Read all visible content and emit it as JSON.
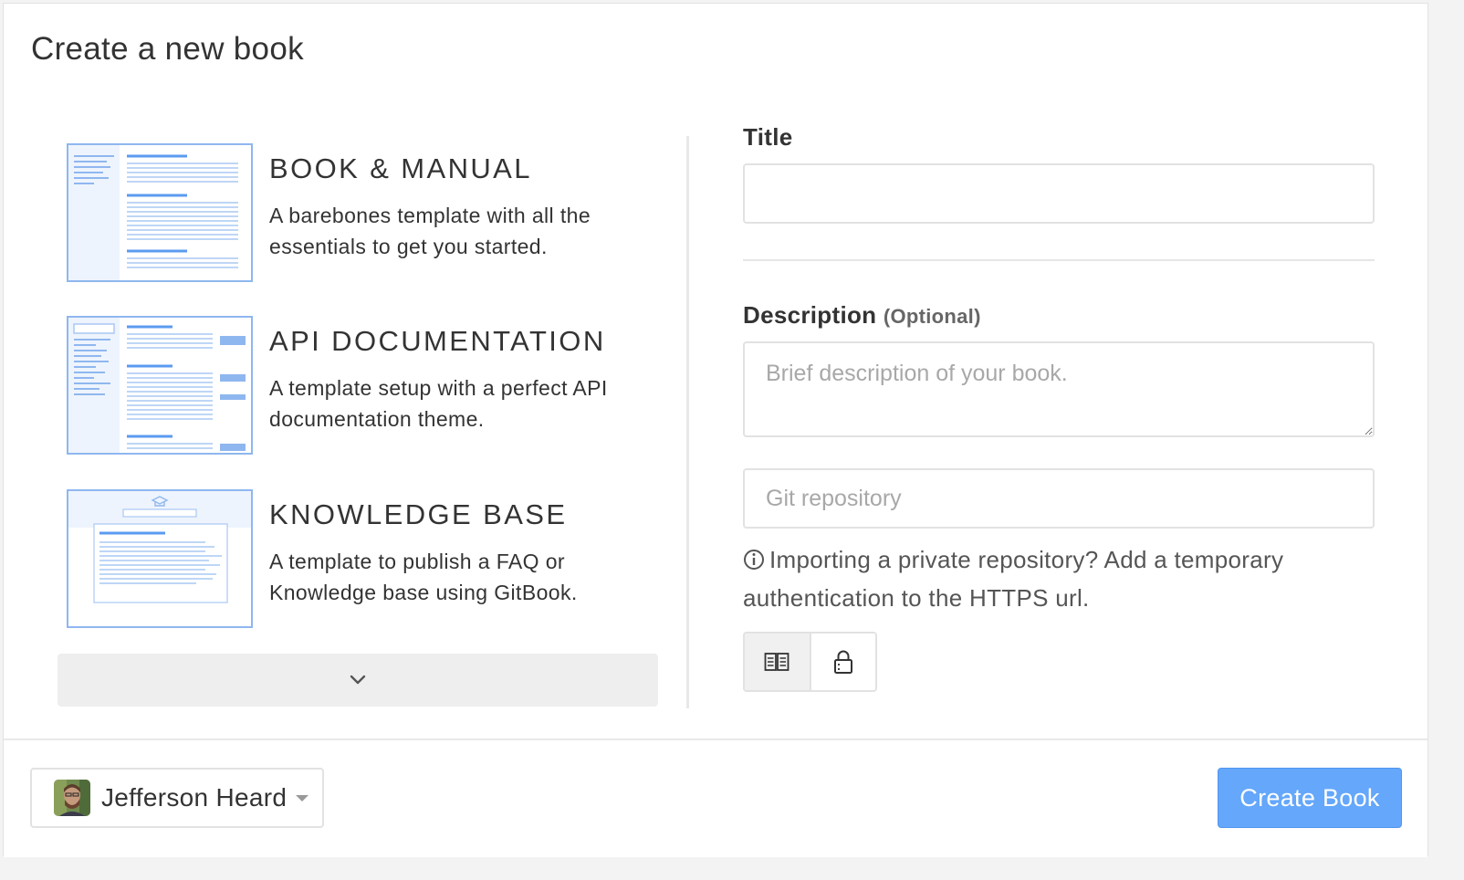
{
  "dialog": {
    "title": "Create a new book"
  },
  "templates": [
    {
      "name": "BOOK & MANUAL",
      "description": "A barebones template with all the essentials to get you started."
    },
    {
      "name": "API DOCUMENTATION",
      "description": "A template setup with a perfect API documentation theme."
    },
    {
      "name": "KNOWLEDGE BASE",
      "description": "A template to publish a FAQ or Knowledge base using GitBook."
    }
  ],
  "form": {
    "title_label": "Title",
    "title_value": "",
    "description_label": "Description",
    "description_optional": "(Optional)",
    "description_placeholder": "Brief description of your book.",
    "git_placeholder": "Git repository",
    "git_hint": "Importing a private repository? Add a temporary authentication to the HTTPS url."
  },
  "visibility": {
    "selected": "public",
    "options": [
      "public-book-icon",
      "private-lock-icon"
    ]
  },
  "footer": {
    "owner_name": "Jefferson Heard",
    "create_label": "Create Book"
  },
  "colors": {
    "accent": "#64a7fb",
    "thumb_line": "#8fb7ef",
    "thumb_accent": "#5b9bf0"
  }
}
